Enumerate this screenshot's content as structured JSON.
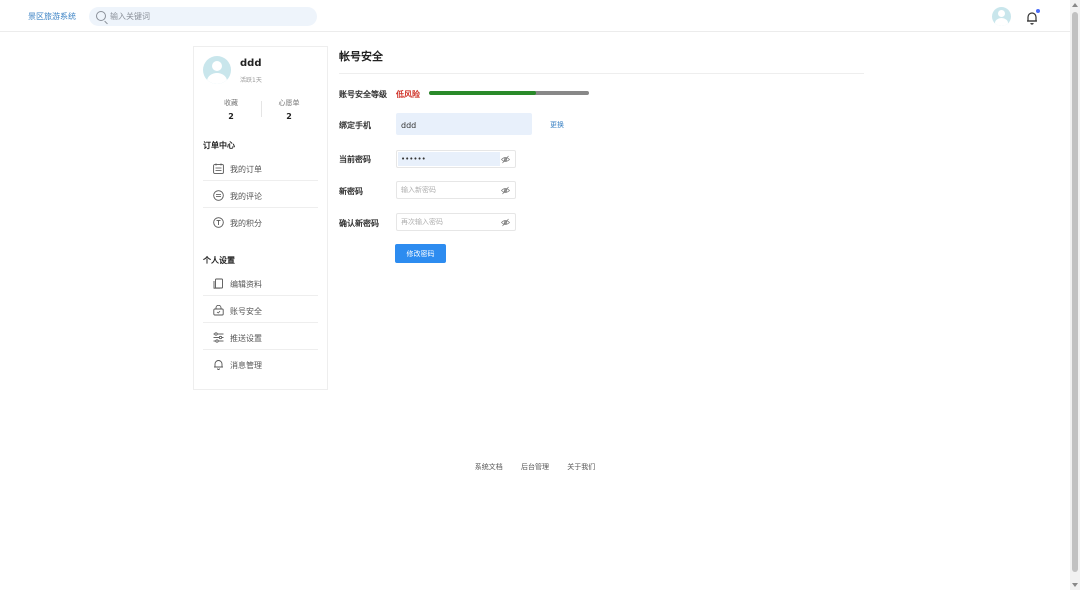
{
  "header": {
    "logo": "景区旅游系统",
    "search_placeholder": "输入关键词"
  },
  "profile": {
    "name": "ddd",
    "days": "活跃1天",
    "stats": [
      {
        "label": "收藏",
        "value": "2"
      },
      {
        "label": "心愿单",
        "value": "2"
      }
    ]
  },
  "sidebar": {
    "order_center_title": "订单中心",
    "order_items": [
      {
        "label": "我的订单",
        "icon": "calendar-icon"
      },
      {
        "label": "我的评论",
        "icon": "comment-icon"
      },
      {
        "label": "我的积分",
        "icon": "points-icon"
      }
    ],
    "settings_title": "个人设置",
    "settings_items": [
      {
        "label": "编辑资料",
        "icon": "document-icon"
      },
      {
        "label": "账号安全",
        "icon": "lock-icon"
      },
      {
        "label": "推送设置",
        "icon": "sliders-icon"
      },
      {
        "label": "消息管理",
        "icon": "bell-icon"
      }
    ]
  },
  "main": {
    "title": "帐号安全",
    "security_level_label": "账号安全等级",
    "risk_text": "低风险",
    "security_progress": 0.67,
    "phone_label": "绑定手机",
    "phone_value": "ddd",
    "change_link": "更换",
    "current_pw_label": "当前密码",
    "current_pw_value": "••••••",
    "new_pw_label": "新密码",
    "new_pw_placeholder": "输入新密码",
    "confirm_pw_label": "确认新密码",
    "confirm_pw_placeholder": "再次输入密码",
    "submit_label": "修改密码"
  },
  "footer": {
    "links": [
      "系统文档",
      "后台管理",
      "关于我们"
    ]
  },
  "colors": {
    "accent": "#2d8cf0",
    "risk": "#d0352b",
    "progress": "#2a8a2a"
  }
}
